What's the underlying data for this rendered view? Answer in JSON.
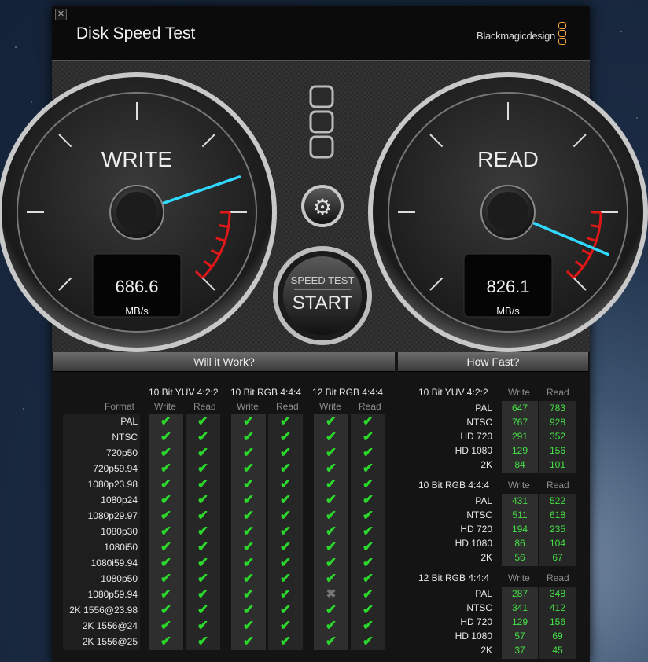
{
  "window": {
    "title": "Disk Speed Test",
    "brand": "Blackmagicdesign"
  },
  "write_gauge": {
    "label": "WRITE",
    "value": "686.6",
    "unit": "MB/s",
    "speed": 686.6
  },
  "read_gauge": {
    "label": "READ",
    "value": "826.1",
    "unit": "MB/s",
    "speed": 826.1
  },
  "start_button": {
    "top": "SPEED TEST",
    "label": "START"
  },
  "will_it_work": {
    "title": "Will it Work?",
    "format_header": "Format",
    "groups": [
      {
        "name": "10 Bit YUV 4:2:2",
        "write": "Write",
        "read": "Read"
      },
      {
        "name": "10 Bit RGB 4:4:4",
        "write": "Write",
        "read": "Read"
      },
      {
        "name": "12 Bit RGB 4:4:4",
        "write": "Write",
        "read": "Read"
      }
    ],
    "formats": [
      "PAL",
      "NTSC",
      "720p50",
      "720p59.94",
      "1080p23.98",
      "1080p24",
      "1080p29.97",
      "1080p30",
      "1080i50",
      "1080i59.94",
      "1080p50",
      "1080p59.94",
      "2K 1556@23.98",
      "2K 1556@24",
      "2K 1556@25"
    ],
    "failed": {
      "row": 11,
      "col": 4
    }
  },
  "how_fast": {
    "title": "How Fast?",
    "groups": [
      {
        "name": "10 Bit YUV 4:2:2",
        "write": "Write",
        "read": "Read",
        "rows": [
          [
            "PAL",
            "647",
            "783"
          ],
          [
            "NTSC",
            "767",
            "928"
          ],
          [
            "HD 720",
            "291",
            "352"
          ],
          [
            "HD 1080",
            "129",
            "156"
          ],
          [
            "2K",
            "84",
            "101"
          ]
        ]
      },
      {
        "name": "10 Bit RGB 4:4:4",
        "write": "Write",
        "read": "Read",
        "rows": [
          [
            "PAL",
            "431",
            "522"
          ],
          [
            "NTSC",
            "511",
            "618"
          ],
          [
            "HD 720",
            "194",
            "235"
          ],
          [
            "HD 1080",
            "86",
            "104"
          ],
          [
            "2K",
            "56",
            "67"
          ]
        ]
      },
      {
        "name": "12 Bit RGB 4:4:4",
        "write": "Write",
        "read": "Read",
        "rows": [
          [
            "PAL",
            "287",
            "348"
          ],
          [
            "NTSC",
            "341",
            "412"
          ],
          [
            "HD 720",
            "129",
            "156"
          ],
          [
            "HD 1080",
            "57",
            "69"
          ],
          [
            "2K",
            "37",
            "45"
          ]
        ]
      }
    ]
  },
  "colors": {
    "check": "#2bd82b",
    "number": "#44e044",
    "needle": "#2fd9ff",
    "redzone": "#e01818",
    "brand_orange": "#f2a33a"
  }
}
